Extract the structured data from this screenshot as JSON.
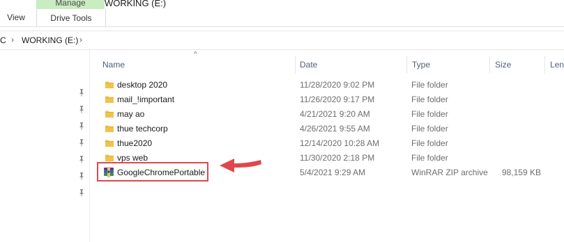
{
  "ribbon": {
    "context_tab": "Manage",
    "tools_tab": "Drive Tools",
    "view_tab": "View",
    "title": "WORKING (E:)"
  },
  "address": {
    "prefix": "C",
    "location": "WORKING (E:)"
  },
  "columns": {
    "name": "Name",
    "date": "Date",
    "type": "Type",
    "size": "Size",
    "length": "Len"
  },
  "files": [
    {
      "name": "desktop 2020",
      "date": "11/28/2020 9:02 PM",
      "type": "File folder",
      "size": "",
      "icon": "folder-icon"
    },
    {
      "name": "mail_!important",
      "date": "11/26/2020 9:17 PM",
      "type": "File folder",
      "size": "",
      "icon": "folder-icon"
    },
    {
      "name": "may ao",
      "date": "4/21/2021 9:20 AM",
      "type": "File folder",
      "size": "",
      "icon": "folder-icon"
    },
    {
      "name": "thue techcorp",
      "date": "4/26/2021 9:55 AM",
      "type": "File folder",
      "size": "",
      "icon": "folder-icon"
    },
    {
      "name": "thue2020",
      "date": "12/14/2020 10:28 AM",
      "type": "File folder",
      "size": "",
      "icon": "folder-icon"
    },
    {
      "name": "vps web",
      "date": "11/30/2020 2:18 PM",
      "type": "File folder",
      "size": "",
      "icon": "folder-icon"
    },
    {
      "name": "GoogleChromePortable",
      "date": "5/4/2021 9:29 AM",
      "type": "WinRAR ZIP archive",
      "size": "98,159 KB",
      "icon": "winrar-archive-icon"
    }
  ],
  "colors": {
    "highlight": "#e0474c",
    "folder": "#f2c14e",
    "context_tab": "#c9ecc2"
  }
}
